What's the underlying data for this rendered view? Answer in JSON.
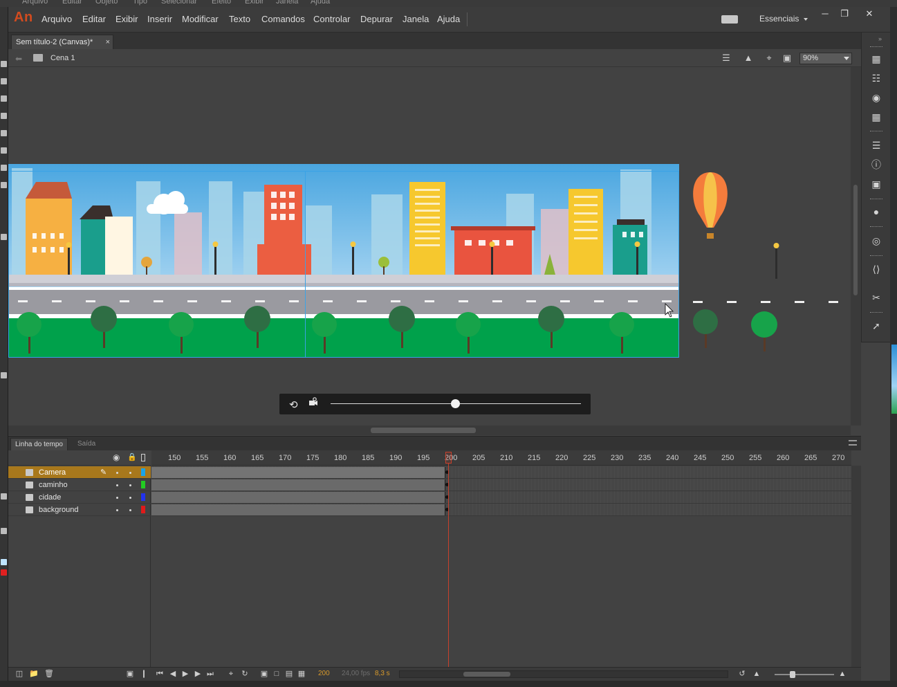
{
  "bg_menu": [
    "Arquivo",
    "Editar",
    "Objeto",
    "Tipo",
    "Selecionar",
    "Efeito",
    "Exibir",
    "Janela",
    "Ajuda"
  ],
  "app": {
    "logo": "An",
    "menu": [
      "Arquivo",
      "Editar",
      "Exibir",
      "Inserir",
      "Modificar",
      "Texto",
      "Comandos",
      "Controlar",
      "Depurar",
      "Janela",
      "Ajuda"
    ],
    "workspace": "Essenciais",
    "window_controls": [
      "minimize-icon",
      "restore-icon",
      "close-icon"
    ]
  },
  "document": {
    "tab_title": "Sem título-2 (Canvas)*",
    "tab_close": "×",
    "scene": "Cena 1",
    "zoom": "90%"
  },
  "camera_control": {
    "icons": [
      "camera-rotate-icon",
      "camera-zoom-icon"
    ],
    "slider_position": 0.5
  },
  "right_panel_icons": [
    "library-icon",
    "color-icon",
    "swatches-icon",
    "align-icon",
    "info-icon",
    "transform-icon",
    "components-icon",
    "cc-libraries-icon",
    "code-snippets-icon",
    "motion-presets-icon",
    "output-icon"
  ],
  "timeline": {
    "tabs": [
      "Linha do tempo",
      "Saída"
    ],
    "ticks": [
      "150",
      "155",
      "160",
      "165",
      "170",
      "175",
      "180",
      "185",
      "190",
      "195",
      "200",
      "205",
      "210",
      "215",
      "220",
      "225",
      "230",
      "235",
      "240",
      "245",
      "250",
      "255",
      "260",
      "265",
      "270"
    ],
    "layers": [
      {
        "name": "Camera",
        "color": "#1aa3e8",
        "selected": true
      },
      {
        "name": "caminho",
        "color": "#22cc22",
        "selected": false
      },
      {
        "name": "cidade",
        "color": "#2233ee",
        "selected": false
      },
      {
        "name": "background",
        "color": "#e01a1a",
        "selected": false
      }
    ],
    "current_frame": "200",
    "fps": "24,00 fps",
    "elapsed": "8,3 s",
    "colors": {
      "frame_label": "#d99a2b",
      "playhead": "#c8402c"
    }
  }
}
